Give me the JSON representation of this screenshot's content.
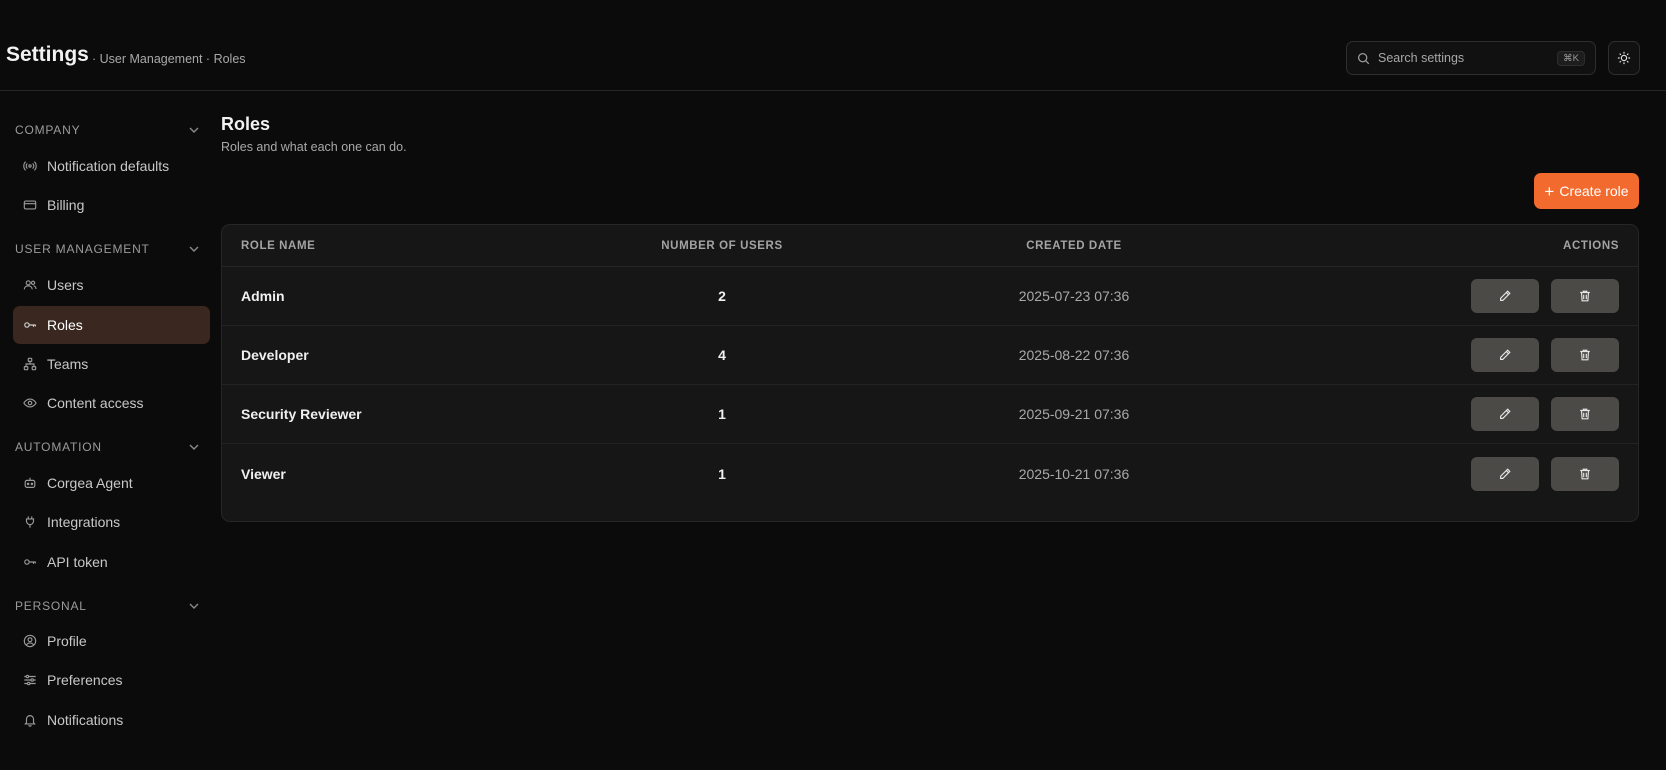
{
  "header": {
    "title": "Settings",
    "breadcrumb": "· User Management · Roles",
    "search_placeholder": "Search settings",
    "search_shortcut": "⌘K"
  },
  "sidebar": {
    "sections": [
      {
        "title": "COMPANY",
        "items": [
          {
            "label": "Notification defaults",
            "icon": "broadcast-icon"
          },
          {
            "label": "Billing",
            "icon": "credit-card-icon"
          }
        ]
      },
      {
        "title": "USER MANAGEMENT",
        "items": [
          {
            "label": "Users",
            "icon": "users-icon"
          },
          {
            "label": "Roles",
            "icon": "key-icon",
            "active": true
          },
          {
            "label": "Teams",
            "icon": "hierarchy-icon"
          },
          {
            "label": "Content access",
            "icon": "eye-icon"
          }
        ]
      },
      {
        "title": "AUTOMATION",
        "items": [
          {
            "label": "Corgea Agent",
            "icon": "bot-icon"
          },
          {
            "label": "Integrations",
            "icon": "plug-icon"
          },
          {
            "label": "API token",
            "icon": "key-icon"
          }
        ]
      },
      {
        "title": "PERSONAL",
        "items": [
          {
            "label": "Profile",
            "icon": "user-circle-icon"
          },
          {
            "label": "Preferences",
            "icon": "sliders-icon"
          },
          {
            "label": "Notifications",
            "icon": "bell-icon"
          }
        ]
      }
    ]
  },
  "main": {
    "title": "Roles",
    "subtitle": "Roles and what each one can do.",
    "create_label": "Create role",
    "columns": [
      "ROLE NAME",
      "NUMBER OF USERS",
      "CREATED DATE",
      "ACTIONS"
    ],
    "rows": [
      {
        "name": "Admin",
        "users": "2",
        "created": "2025-07-23 07:36"
      },
      {
        "name": "Developer",
        "users": "4",
        "created": "2025-08-22 07:36"
      },
      {
        "name": "Security Reviewer",
        "users": "1",
        "created": "2025-09-21 07:36"
      },
      {
        "name": "Viewer",
        "users": "1",
        "created": "2025-10-21 07:36"
      }
    ]
  },
  "colors": {
    "accent": "#f26a2e",
    "active_nav_bg": "#3a2820",
    "background": "#0b0b0b",
    "card": "#161616"
  }
}
